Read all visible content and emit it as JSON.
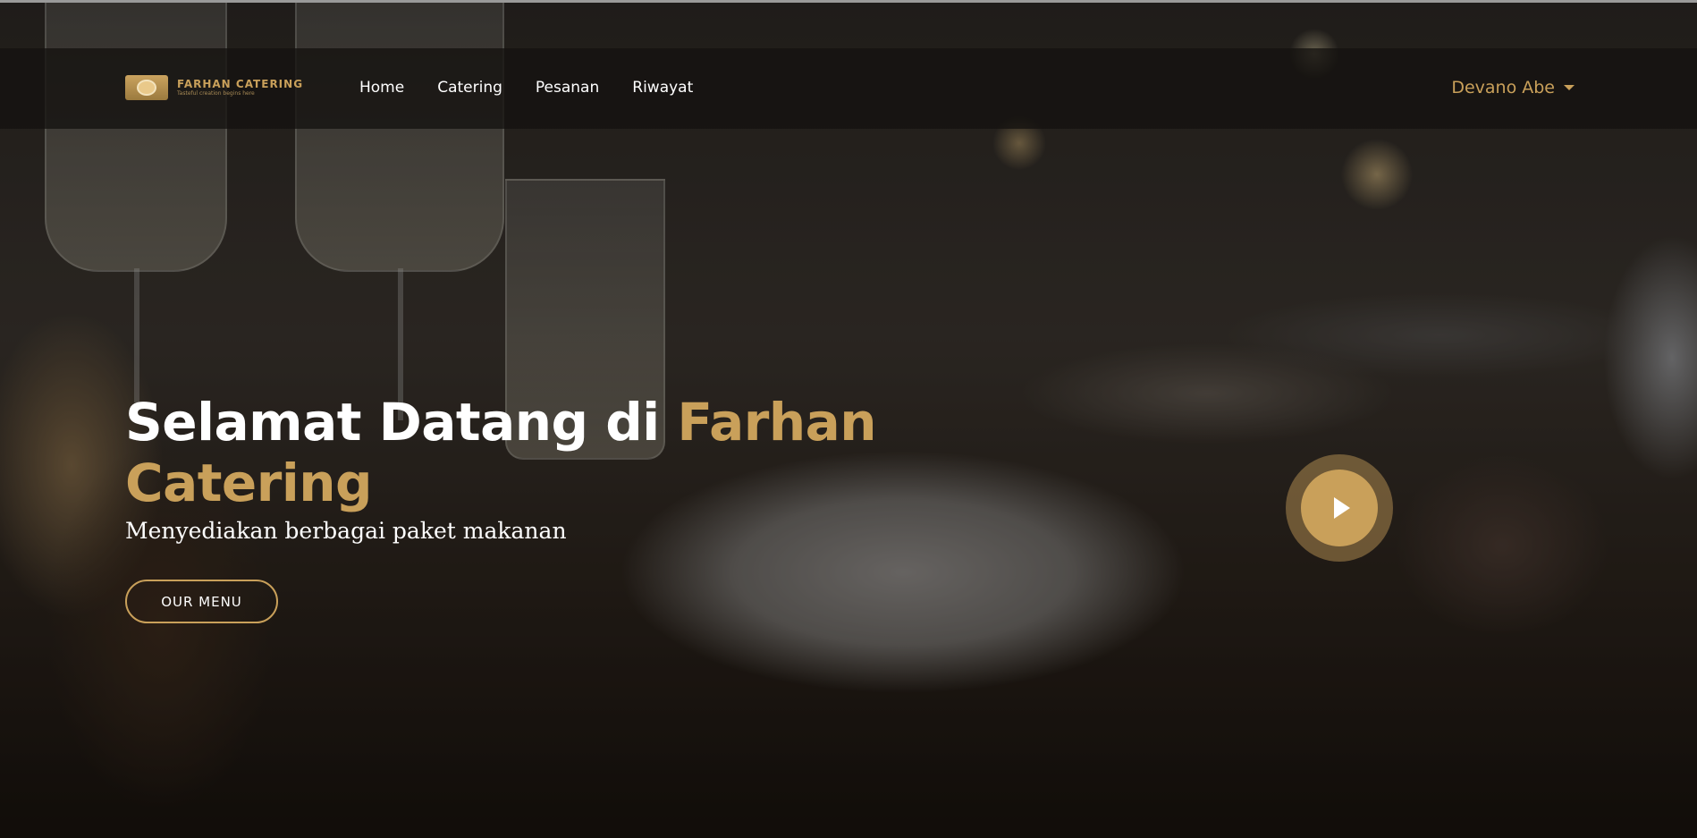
{
  "brand": {
    "name": "FARHAN CATERING",
    "tagline": "Tasteful creation begins here"
  },
  "nav": {
    "links": [
      "Home",
      "Catering",
      "Pesanan",
      "Riwayat"
    ]
  },
  "user": {
    "name": "Devano Abe"
  },
  "hero": {
    "title_part1": "Selamat Datang di ",
    "title_accent": "Farhan Catering",
    "subtitle": "Menyediakan berbagai paket makanan",
    "button_label": "OUR MENU"
  },
  "icons": {
    "play": "play-icon",
    "dropdown": "caret-down-icon"
  },
  "colors": {
    "accent": "#c9a05a",
    "navbar_bg": "#141210",
    "text": "#ffffff"
  }
}
